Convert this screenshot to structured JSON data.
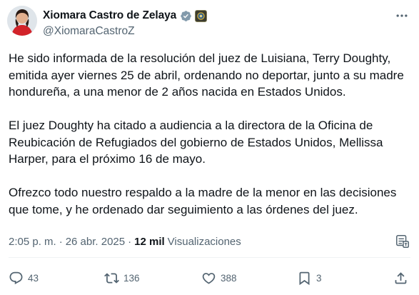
{
  "author": {
    "name": "Xiomara Castro de Zelaya",
    "handle": "@XiomaraCastroZ"
  },
  "post": {
    "paragraphs": [
      "He sido informada de la resolución del juez de Luisiana, Terry Doughty, emitida ayer viernes 25 de abril, ordenando no deportar, junto a su madre hondureña, a una menor de 2 años nacida en Estados Unidos.",
      "El juez Doughty ha citado a audiencia a la directora de la Oficina de Reubicación de Refugiados del gobierno de Estados Unidos, Mellissa Harper, para el próximo 16 de mayo.",
      "Ofrezco todo nuestro respaldo a la madre de la menor en las decisiones que tome, y he ordenado dar seguimiento a las órdenes del juez."
    ]
  },
  "meta": {
    "time": "2:05 p. m.",
    "separator": "·",
    "date": "26 abr. 2025",
    "views_count": "12 mil",
    "views_label": "Visualizaciones"
  },
  "actions": {
    "replies": "43",
    "reposts": "136",
    "likes": "388",
    "bookmarks": "3"
  },
  "icons": [
    "verified-badge-icon",
    "government-affiliation-icon",
    "more-options-icon",
    "translate-icon",
    "reply-icon",
    "repost-icon",
    "like-icon",
    "bookmark-icon",
    "share-icon"
  ],
  "colors": {
    "text": "#0f1419",
    "secondary": "#536471",
    "verified": "#829aab"
  }
}
